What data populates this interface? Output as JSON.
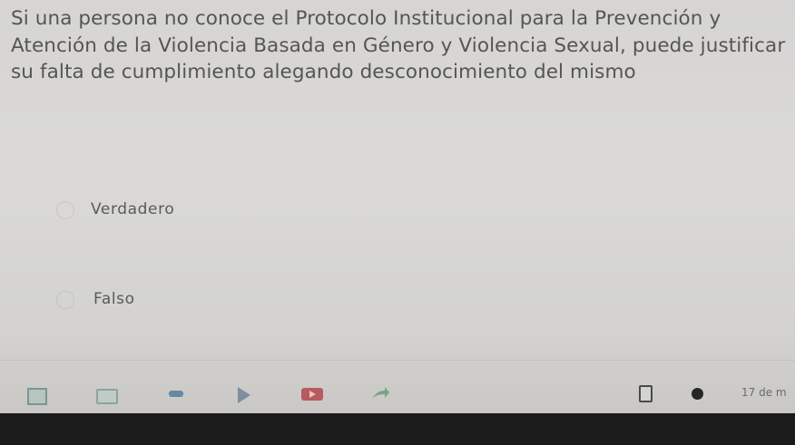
{
  "question": {
    "text": "Si una persona no conoce el Protocolo Institucional para la Prevención y Atención de la Violencia Basada en Género y Violencia Sexual, puede justificar su falta de cumplimiento alegando desconocimiento del mismo"
  },
  "options": [
    {
      "label": "Verdadero"
    },
    {
      "label": "Falso"
    }
  ],
  "toolbar": {
    "icons": [
      "square-icon",
      "film-icon",
      "chat-icon",
      "play-icon",
      "video-icon",
      "share-icon",
      "flag-icon",
      "help-icon"
    ],
    "page_count": "17 de m"
  },
  "colors": {
    "background": "#d8d7d4",
    "text": "#555556",
    "video_red": "#b85a5e",
    "chat_blue": "#6787a6"
  }
}
